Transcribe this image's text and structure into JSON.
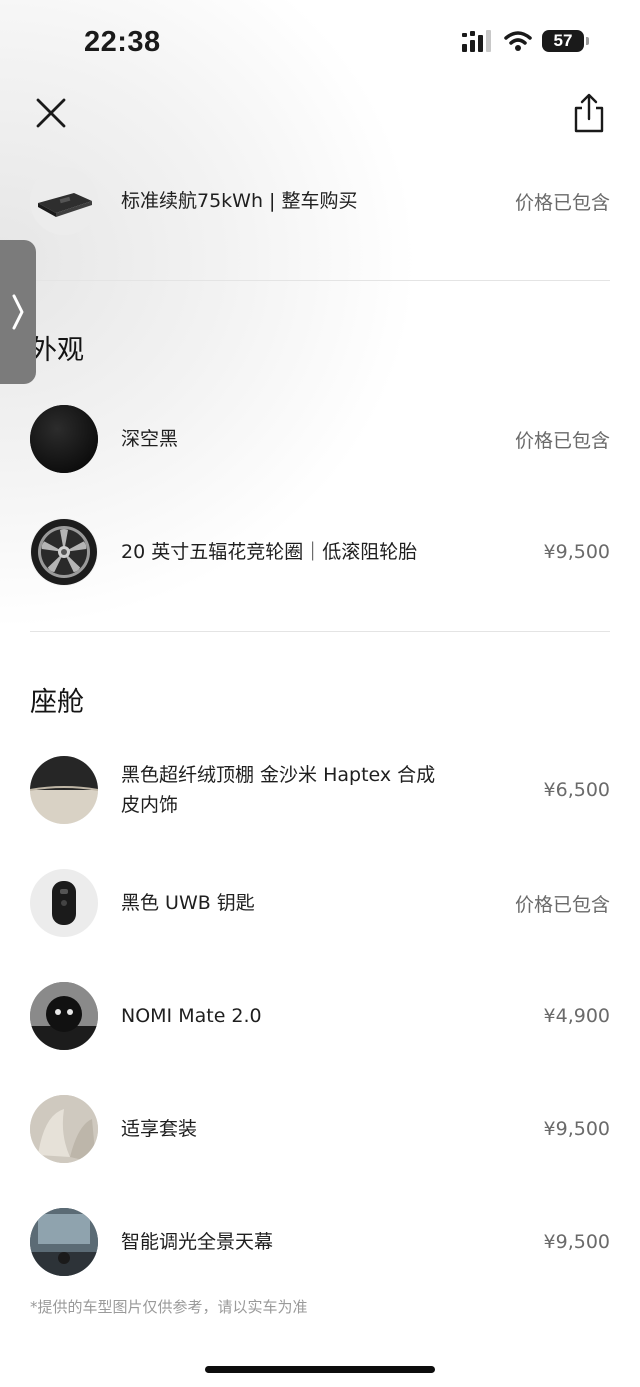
{
  "status_bar": {
    "time": "22:38",
    "battery": "57"
  },
  "top_bar": {
    "close_icon": "close-icon",
    "share_icon": "share-icon"
  },
  "side_tab": {
    "icon": "chevron-right-icon"
  },
  "battery_pack": {
    "label": "标准续航75kWh | 整车购买",
    "price": "价格已包含"
  },
  "exterior": {
    "title": "外观",
    "items": [
      {
        "label": "深空黑",
        "price": "价格已包含"
      },
      {
        "label": "20 英寸五辐花竞轮圈｜低滚阻轮胎",
        "price": "¥9,500"
      }
    ]
  },
  "cabin": {
    "title": "座舱",
    "items": [
      {
        "label": "黑色超纤绒顶棚 金沙米 Haptex 合成皮内饰",
        "price": "¥6,500"
      },
      {
        "label": "黑色 UWB 钥匙",
        "price": "价格已包含"
      },
      {
        "label": "NOMI Mate 2.0",
        "price": "¥4,900"
      },
      {
        "label": "适享套装",
        "price": "¥9,500"
      },
      {
        "label": "智能调光全景天幕",
        "price": "¥9,500"
      }
    ]
  },
  "disclaimer": "*提供的车型图片仅供参考，请以实车为准",
  "colors": {
    "text": "#1a1a1a",
    "muted": "#6a6a6a",
    "divider": "#e4e4e4",
    "side_tab": "#7b7b7b"
  }
}
